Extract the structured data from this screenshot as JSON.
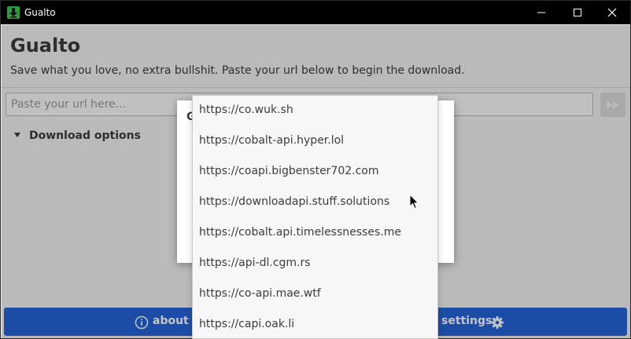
{
  "window": {
    "title": "Gualto",
    "controls": [
      "minimize",
      "maximize",
      "close"
    ]
  },
  "app": {
    "title": "Gualto",
    "subtitle": "Save what you love, no extra bullshit. Paste your url below to begin the download."
  },
  "url_input": {
    "placeholder": "Paste your url here...",
    "value": ""
  },
  "download_options": {
    "label": "Download options",
    "expanded": false
  },
  "dialog": {
    "title_visible": "G"
  },
  "dropdown": {
    "items": [
      "https://co.wuk.sh",
      "https://cobalt-api.hyper.lol",
      "https://coapi.bigbenster702.com",
      "https://downloadapi.stuff.solutions",
      "https://cobalt.api.timelessnesses.me",
      "https://api-dl.cgm.rs",
      "https://co-api.mae.wtf",
      "https://capi.oak.li"
    ]
  },
  "bottom_bar": {
    "about_label": "about",
    "settings_label": "settings"
  },
  "colors": {
    "accent": "#2565d8",
    "titlebar": "#000000",
    "app_icon": "#2e9b3f"
  },
  "icons": {
    "app": "download-arrow-icon",
    "go": "fast-forward-icon",
    "about": "info-circle-icon",
    "settings": "gear-icon",
    "expander": "triangle-down-icon"
  }
}
